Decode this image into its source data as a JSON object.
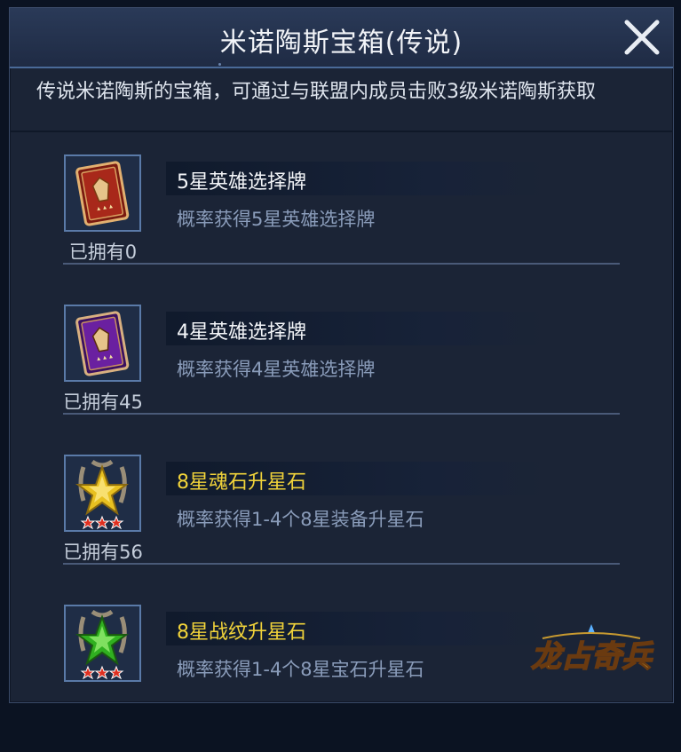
{
  "dialog": {
    "title": "米诺陶斯宝箱(传说)",
    "description": "传说米诺陶斯的宝箱，可通过与联盟内成员击败3级米诺陶斯获取"
  },
  "items": [
    {
      "name": "5星英雄选择牌",
      "subtitle": "概率获得5星英雄选择牌",
      "owned": "已拥有0",
      "name_color": "white",
      "icon": "red-hero-card-icon"
    },
    {
      "name": "4星英雄选择牌",
      "subtitle": "概率获得4星英雄选择牌",
      "owned": "已拥有45",
      "name_color": "white",
      "icon": "purple-hero-card-icon"
    },
    {
      "name": "8星魂石升星石",
      "subtitle": "概率获得1-4个8星装备升星石",
      "owned": "已拥有56",
      "name_color": "gold",
      "icon": "gold-star-stone-icon"
    },
    {
      "name": "8星战纹升星石",
      "subtitle": "概率获得1-4个8星宝石升星石",
      "owned": "",
      "name_color": "gold",
      "icon": "green-star-stone-icon"
    }
  ],
  "logo": {
    "text": "龙占奇兵"
  },
  "colors": {
    "gold": "#f1d33a",
    "subtitle": "#8a9cba",
    "header": "#2a3a58"
  }
}
